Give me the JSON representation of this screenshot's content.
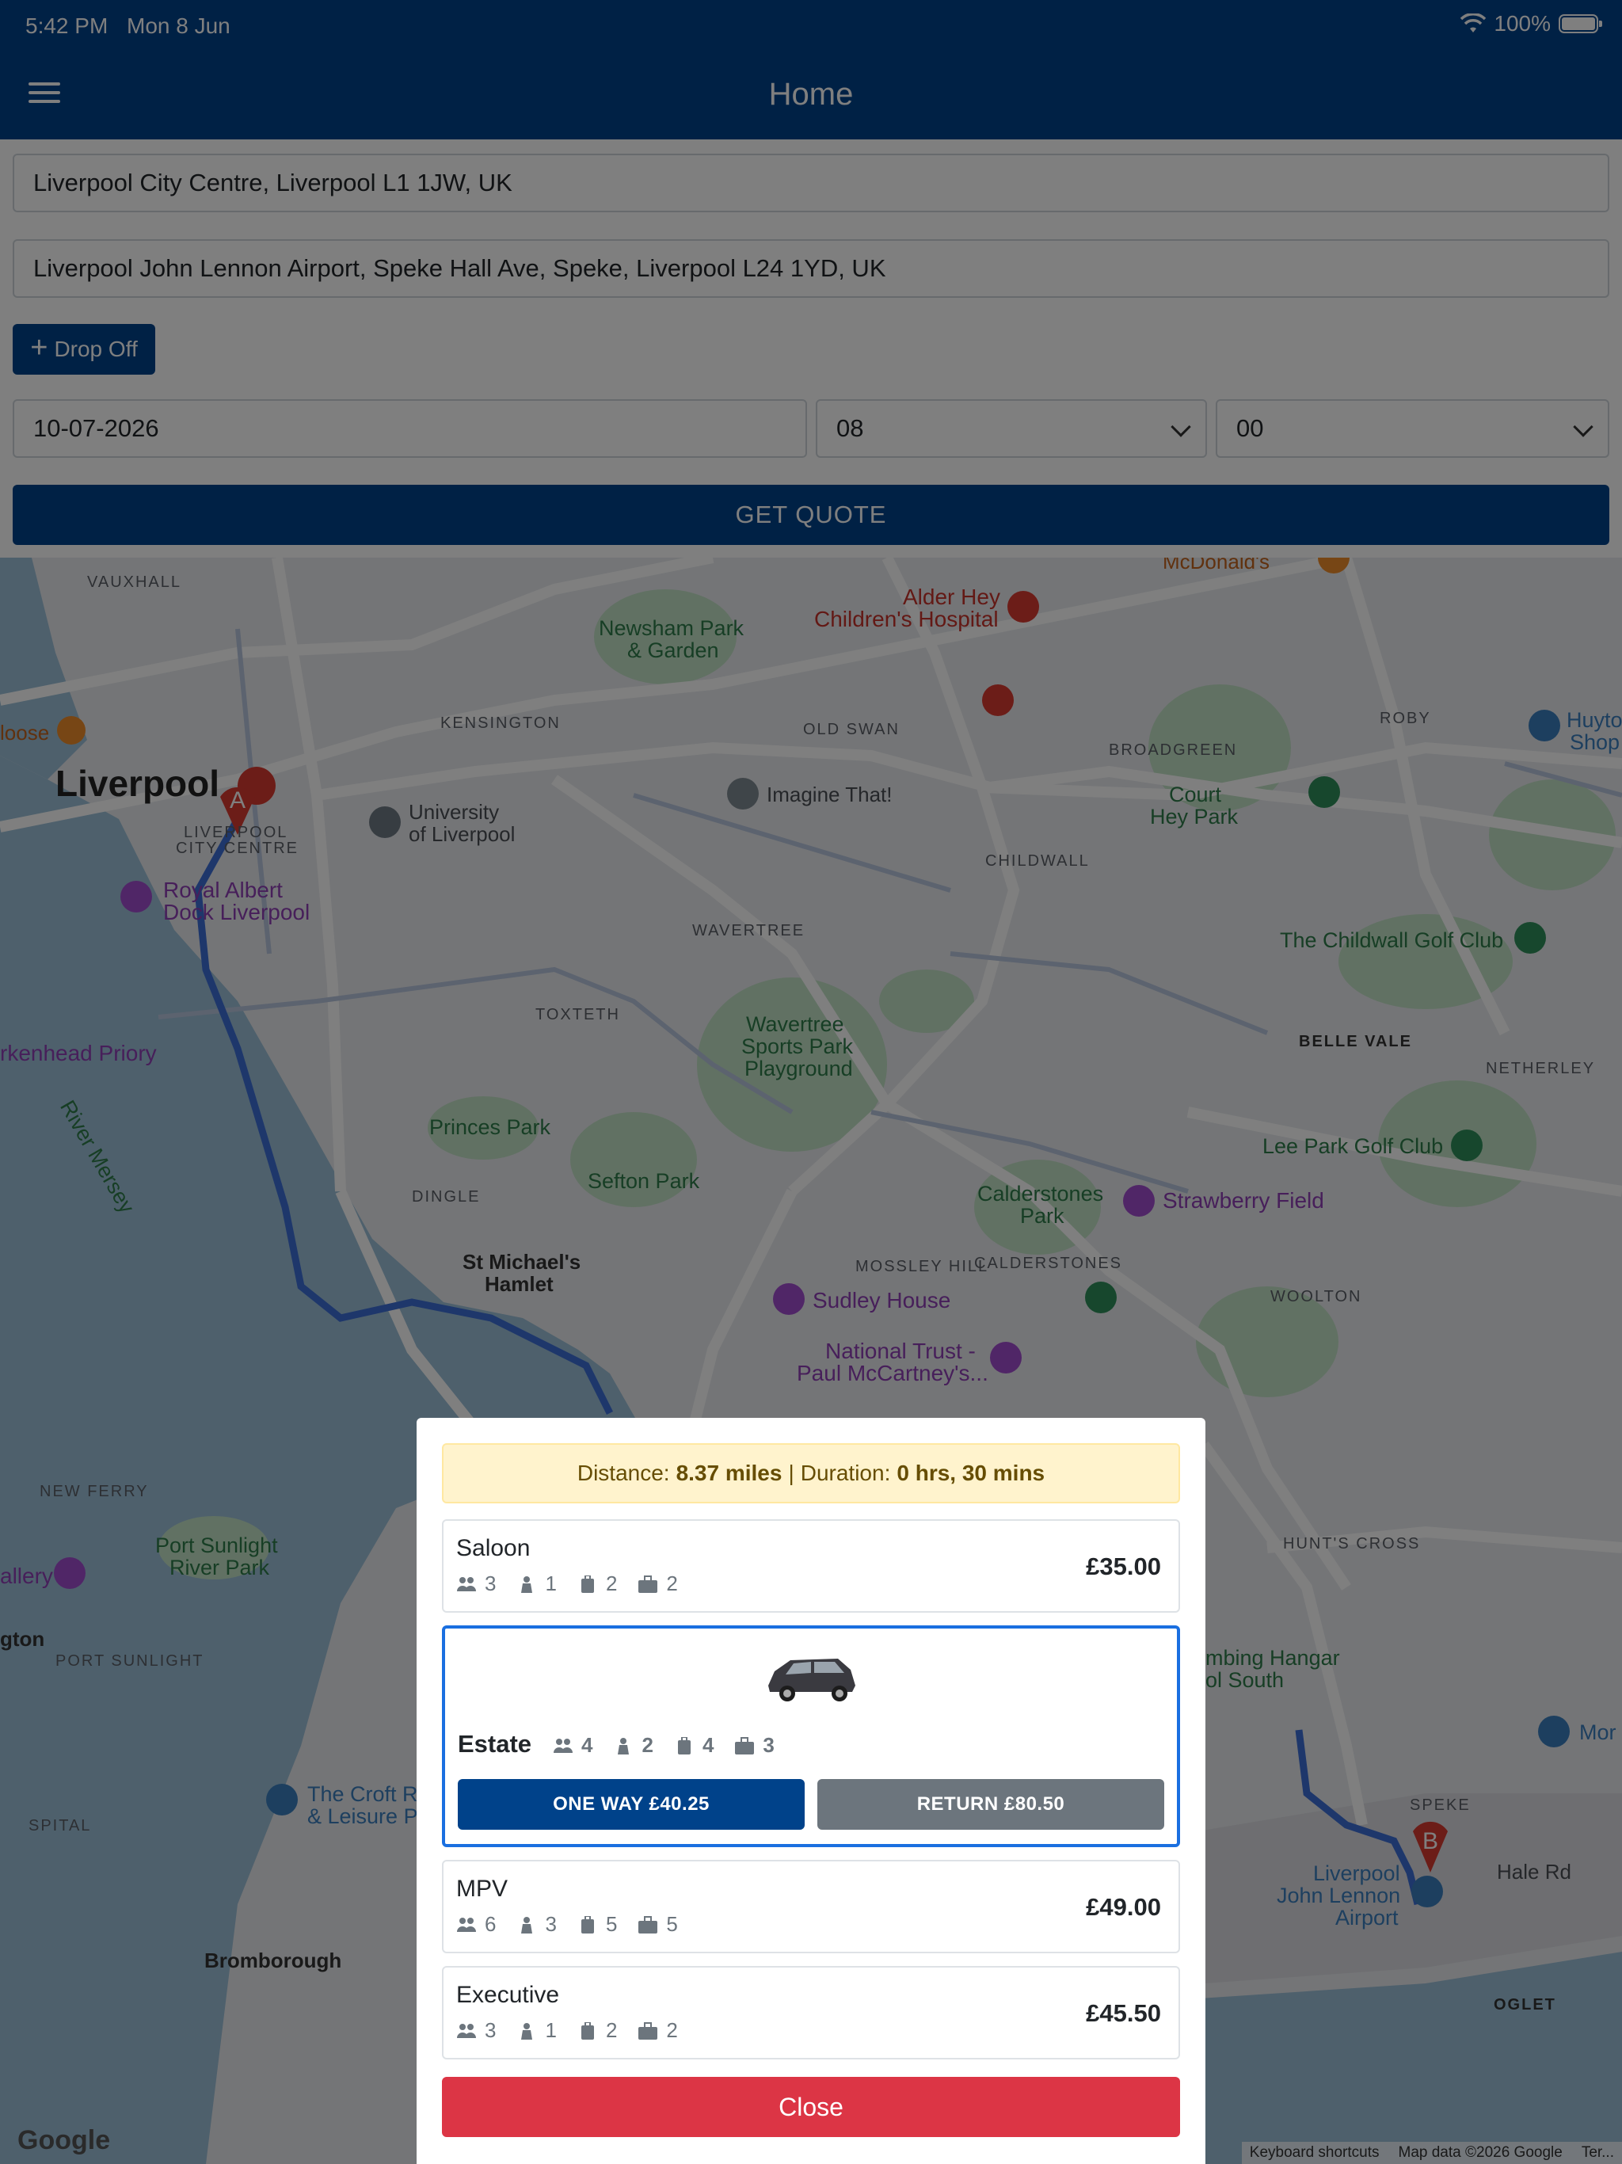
{
  "status": {
    "time": "5:42 PM",
    "date": "Mon 8 Jun",
    "battery": "100%"
  },
  "nav": {
    "title": "Home"
  },
  "form": {
    "pickup": "Liverpool City Centre, Liverpool L1 1JW, UK",
    "destination": "Liverpool John Lennon Airport, Speke Hall Ave, Speke, Liverpool L24 1YD, UK",
    "dropoff_label": "Drop Off",
    "date": "10-07-2026",
    "hour": "08",
    "minute": "00",
    "quote_label": "GET QUOTE"
  },
  "map": {
    "labels": {
      "vauxhall": "VAUXHALL",
      "liverpool": "Liverpool",
      "city_centre_1": "LIVERPOOL",
      "city_centre_2": "CITY CENTRE",
      "royal_albert": "Royal Albert",
      "dock": "Dock Liverpool",
      "university1": "University",
      "university2": "of Liverpool",
      "newsham1": "Newsham Park",
      "newsham2": "& Garden",
      "alder1": "Alder Hey",
      "alder2": "Children's Hospital",
      "kensington": "KENSINGTON",
      "old_swan": "OLD SWAN",
      "roby": "ROBY",
      "broadgreen": "BROADGREEN",
      "imagine": "Imagine That!",
      "court1": "Court",
      "court2": "Hey Park",
      "childwall": "CHILDWALL",
      "wavertree": "WAVERTREE",
      "toxteth": "TOXTETH",
      "childwall_golf": "The Childwall Golf Club",
      "belle_vale": "BELLE VALE",
      "netherley": "NETHERLEY",
      "birkenhead": "rkenhead Priory",
      "river_mersey": "River Mersey",
      "wavertree_park1": "Wavertree",
      "wavertree_park2": "Sports Park",
      "wavertree_park3": "Playground",
      "princes_park": "Princes Park",
      "sefton_park": "Sefton Park",
      "lee_park": "Lee Park Golf Club",
      "calderstones1": "Calderstones",
      "calderstones2": "Park",
      "strawberry": "Strawberry Field",
      "dingle": "DINGLE",
      "st_michaels1": "St Michael's",
      "st_michaels2": "Hamlet",
      "mossley": "MOSSLEY HILL",
      "calderstones_caps": "CALDERSTONES",
      "sudley": "Sudley House",
      "woolton": "WOOLTON",
      "national_trust1": "National Trust -",
      "national_trust2": "Paul McCartney's...",
      "new_ferry": "NEW FERRY",
      "port_sunlight1": "Port Sunlight",
      "port_sunlight2": "River Park",
      "port_sunlight_caps": "PORT SUNLIGHT",
      "hunts_cross": "HUNT'S CROSS",
      "speke": "SPEKE",
      "airport1": "Liverpool",
      "airport2": "John Lennon",
      "airport3": "Airport",
      "spital": "SPITAL",
      "bromborough": "Bromborough",
      "oglet": "OGLET",
      "croft1": "The Croft R",
      "croft2": "& Leisure P",
      "hangar1": "mbing Hangar",
      "hangar2": "ol South",
      "gallery": "allery",
      "gton": "gton",
      "hale_rd": "Hale Rd",
      "huyton": "Huyto",
      "huyton2": "Shop",
      "mor": "Mor",
      "loose": "loose",
      "mcdonalds": "McDonald's",
      "marker_a": "A",
      "marker_b": "B"
    },
    "google": "Google",
    "footer": {
      "shortcuts": "Keyboard shortcuts",
      "copyright": "Map data ©2026 Google",
      "terms": "Ter..."
    }
  },
  "modal": {
    "distance_label": "Distance:",
    "distance_value": "8.37 miles",
    "separator": "|",
    "duration_label": "Duration:",
    "duration_value": "0 hrs, 30 mins",
    "vehicles": [
      {
        "name": "Saloon",
        "passengers": "3",
        "child_seats": "1",
        "luggage": "2",
        "bags": "2",
        "price": "£35.00"
      },
      {
        "name": "Estate",
        "passengers": "4",
        "child_seats": "2",
        "luggage": "4",
        "bags": "3",
        "one_way": "ONE WAY £40.25",
        "return": "RETURN £80.50"
      },
      {
        "name": "MPV",
        "passengers": "6",
        "child_seats": "3",
        "luggage": "5",
        "bags": "5",
        "price": "£49.00"
      },
      {
        "name": "Executive",
        "passengers": "3",
        "child_seats": "1",
        "luggage": "2",
        "bags": "2",
        "price": "£45.50"
      }
    ],
    "close_label": "Close"
  },
  "colors": {
    "primary": "#00428a",
    "danger": "#dc3545",
    "secondary": "#6c757d",
    "alert_bg": "#fff3cd",
    "selected_border": "#1a6fe0"
  }
}
